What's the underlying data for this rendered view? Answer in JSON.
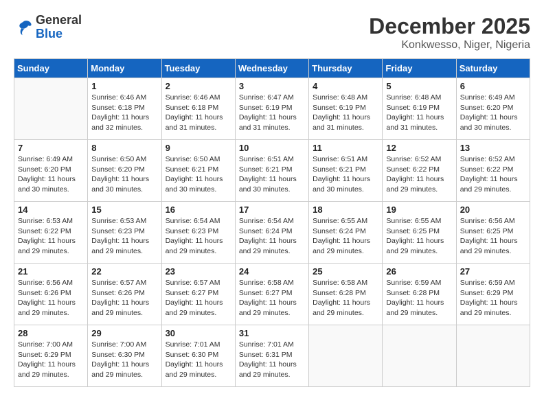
{
  "header": {
    "logo_general": "General",
    "logo_blue": "Blue",
    "title": "December 2025",
    "subtitle": "Konkwesso, Niger, Nigeria"
  },
  "days_of_week": [
    "Sunday",
    "Monday",
    "Tuesday",
    "Wednesday",
    "Thursday",
    "Friday",
    "Saturday"
  ],
  "weeks": [
    [
      {
        "day": "",
        "sunrise": "",
        "sunset": "",
        "daylight": ""
      },
      {
        "day": "1",
        "sunrise": "Sunrise: 6:46 AM",
        "sunset": "Sunset: 6:18 PM",
        "daylight": "Daylight: 11 hours and 32 minutes."
      },
      {
        "day": "2",
        "sunrise": "Sunrise: 6:46 AM",
        "sunset": "Sunset: 6:18 PM",
        "daylight": "Daylight: 11 hours and 31 minutes."
      },
      {
        "day": "3",
        "sunrise": "Sunrise: 6:47 AM",
        "sunset": "Sunset: 6:19 PM",
        "daylight": "Daylight: 11 hours and 31 minutes."
      },
      {
        "day": "4",
        "sunrise": "Sunrise: 6:48 AM",
        "sunset": "Sunset: 6:19 PM",
        "daylight": "Daylight: 11 hours and 31 minutes."
      },
      {
        "day": "5",
        "sunrise": "Sunrise: 6:48 AM",
        "sunset": "Sunset: 6:19 PM",
        "daylight": "Daylight: 11 hours and 31 minutes."
      },
      {
        "day": "6",
        "sunrise": "Sunrise: 6:49 AM",
        "sunset": "Sunset: 6:20 PM",
        "daylight": "Daylight: 11 hours and 30 minutes."
      }
    ],
    [
      {
        "day": "7",
        "sunrise": "Sunrise: 6:49 AM",
        "sunset": "Sunset: 6:20 PM",
        "daylight": "Daylight: 11 hours and 30 minutes."
      },
      {
        "day": "8",
        "sunrise": "Sunrise: 6:50 AM",
        "sunset": "Sunset: 6:20 PM",
        "daylight": "Daylight: 11 hours and 30 minutes."
      },
      {
        "day": "9",
        "sunrise": "Sunrise: 6:50 AM",
        "sunset": "Sunset: 6:21 PM",
        "daylight": "Daylight: 11 hours and 30 minutes."
      },
      {
        "day": "10",
        "sunrise": "Sunrise: 6:51 AM",
        "sunset": "Sunset: 6:21 PM",
        "daylight": "Daylight: 11 hours and 30 minutes."
      },
      {
        "day": "11",
        "sunrise": "Sunrise: 6:51 AM",
        "sunset": "Sunset: 6:21 PM",
        "daylight": "Daylight: 11 hours and 30 minutes."
      },
      {
        "day": "12",
        "sunrise": "Sunrise: 6:52 AM",
        "sunset": "Sunset: 6:22 PM",
        "daylight": "Daylight: 11 hours and 29 minutes."
      },
      {
        "day": "13",
        "sunrise": "Sunrise: 6:52 AM",
        "sunset": "Sunset: 6:22 PM",
        "daylight": "Daylight: 11 hours and 29 minutes."
      }
    ],
    [
      {
        "day": "14",
        "sunrise": "Sunrise: 6:53 AM",
        "sunset": "Sunset: 6:22 PM",
        "daylight": "Daylight: 11 hours and 29 minutes."
      },
      {
        "day": "15",
        "sunrise": "Sunrise: 6:53 AM",
        "sunset": "Sunset: 6:23 PM",
        "daylight": "Daylight: 11 hours and 29 minutes."
      },
      {
        "day": "16",
        "sunrise": "Sunrise: 6:54 AM",
        "sunset": "Sunset: 6:23 PM",
        "daylight": "Daylight: 11 hours and 29 minutes."
      },
      {
        "day": "17",
        "sunrise": "Sunrise: 6:54 AM",
        "sunset": "Sunset: 6:24 PM",
        "daylight": "Daylight: 11 hours and 29 minutes."
      },
      {
        "day": "18",
        "sunrise": "Sunrise: 6:55 AM",
        "sunset": "Sunset: 6:24 PM",
        "daylight": "Daylight: 11 hours and 29 minutes."
      },
      {
        "day": "19",
        "sunrise": "Sunrise: 6:55 AM",
        "sunset": "Sunset: 6:25 PM",
        "daylight": "Daylight: 11 hours and 29 minutes."
      },
      {
        "day": "20",
        "sunrise": "Sunrise: 6:56 AM",
        "sunset": "Sunset: 6:25 PM",
        "daylight": "Daylight: 11 hours and 29 minutes."
      }
    ],
    [
      {
        "day": "21",
        "sunrise": "Sunrise: 6:56 AM",
        "sunset": "Sunset: 6:26 PM",
        "daylight": "Daylight: 11 hours and 29 minutes."
      },
      {
        "day": "22",
        "sunrise": "Sunrise: 6:57 AM",
        "sunset": "Sunset: 6:26 PM",
        "daylight": "Daylight: 11 hours and 29 minutes."
      },
      {
        "day": "23",
        "sunrise": "Sunrise: 6:57 AM",
        "sunset": "Sunset: 6:27 PM",
        "daylight": "Daylight: 11 hours and 29 minutes."
      },
      {
        "day": "24",
        "sunrise": "Sunrise: 6:58 AM",
        "sunset": "Sunset: 6:27 PM",
        "daylight": "Daylight: 11 hours and 29 minutes."
      },
      {
        "day": "25",
        "sunrise": "Sunrise: 6:58 AM",
        "sunset": "Sunset: 6:28 PM",
        "daylight": "Daylight: 11 hours and 29 minutes."
      },
      {
        "day": "26",
        "sunrise": "Sunrise: 6:59 AM",
        "sunset": "Sunset: 6:28 PM",
        "daylight": "Daylight: 11 hours and 29 minutes."
      },
      {
        "day": "27",
        "sunrise": "Sunrise: 6:59 AM",
        "sunset": "Sunset: 6:29 PM",
        "daylight": "Daylight: 11 hours and 29 minutes."
      }
    ],
    [
      {
        "day": "28",
        "sunrise": "Sunrise: 7:00 AM",
        "sunset": "Sunset: 6:29 PM",
        "daylight": "Daylight: 11 hours and 29 minutes."
      },
      {
        "day": "29",
        "sunrise": "Sunrise: 7:00 AM",
        "sunset": "Sunset: 6:30 PM",
        "daylight": "Daylight: 11 hours and 29 minutes."
      },
      {
        "day": "30",
        "sunrise": "Sunrise: 7:01 AM",
        "sunset": "Sunset: 6:30 PM",
        "daylight": "Daylight: 11 hours and 29 minutes."
      },
      {
        "day": "31",
        "sunrise": "Sunrise: 7:01 AM",
        "sunset": "Sunset: 6:31 PM",
        "daylight": "Daylight: 11 hours and 29 minutes."
      },
      {
        "day": "",
        "sunrise": "",
        "sunset": "",
        "daylight": ""
      },
      {
        "day": "",
        "sunrise": "",
        "sunset": "",
        "daylight": ""
      },
      {
        "day": "",
        "sunrise": "",
        "sunset": "",
        "daylight": ""
      }
    ]
  ]
}
